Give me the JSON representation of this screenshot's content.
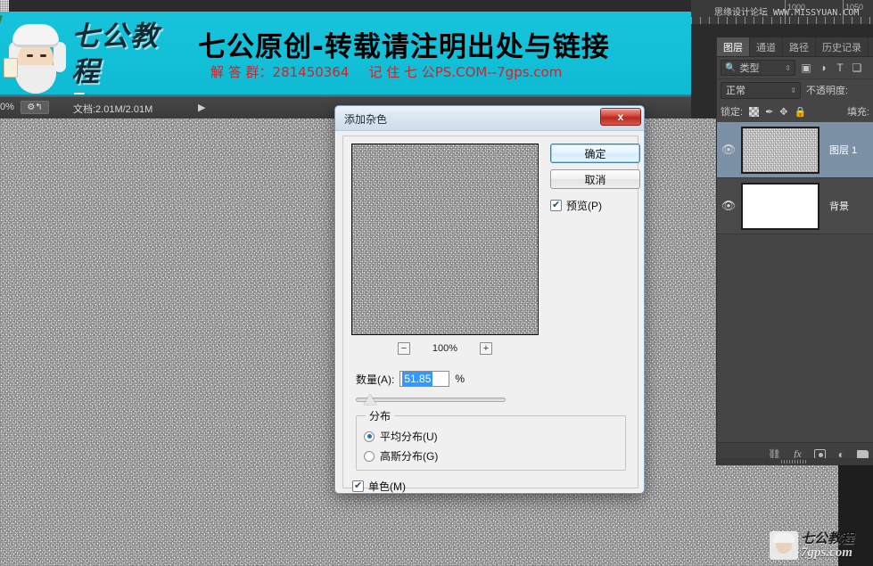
{
  "banner": {
    "logo_cn": "七公教程",
    "logo_en": "7gps.com",
    "headline": "七公原创-转载请注明出处与链接",
    "sub_qq_label": "解 答 群：",
    "sub_qq_number": "281450364",
    "sub_remember": "记 住 七 公PS.COM--7gps.com"
  },
  "statusbar": {
    "zoom": "0%",
    "doc_info": "文档:2.01M/2.01M",
    "arrow_icon": "▶",
    "proof_icon": "⚙↰"
  },
  "ruler": {
    "watermark": "思缘设计论坛 WWW.MISSYUAN.COM",
    "ticks": [
      "1000",
      "1050"
    ]
  },
  "panel": {
    "tabs": [
      {
        "label": "图层",
        "active": true
      },
      {
        "label": "通道",
        "active": false
      },
      {
        "label": "路径",
        "active": false
      },
      {
        "label": "历史记录",
        "active": false
      }
    ],
    "filter": {
      "magnifier_icon": "search-icon",
      "kind_label": "类型",
      "spinner": "⇳",
      "icons": [
        "image-filter-icon",
        "adjustment-filter-icon",
        "type-filter-icon",
        "shape-filter-icon"
      ],
      "type_icon_glyph": "T",
      "image_icon_glyph": "▣",
      "adjust_icon_glyph": "◑",
      "shape_icon_glyph": "❏"
    },
    "blend": {
      "mode": "正常",
      "opacity_label": "不透明度:",
      "spinner": "⇳"
    },
    "lock": {
      "label": "锁定:",
      "transparent_icon": "checker-lock-icon",
      "brush_icon": "✒",
      "move_icon": "✥",
      "all_icon": "🔒",
      "fill_label": "填充:"
    },
    "layers": [
      {
        "name": "图层 1",
        "visible": true,
        "selected": true,
        "thumb": "noise",
        "eye_icon": "👁"
      },
      {
        "name": "背景",
        "visible": true,
        "selected": false,
        "thumb": "white",
        "eye_icon": "👁"
      }
    ],
    "bottom_icons": [
      {
        "name": "link-layers-icon",
        "glyph": "⛓"
      },
      {
        "name": "layer-style-fx-icon",
        "glyph": "fx"
      },
      {
        "name": "layer-mask-icon",
        "glyph": ""
      },
      {
        "name": "adjustment-layer-icon",
        "glyph": "◐"
      },
      {
        "name": "new-group-icon",
        "glyph": ""
      }
    ]
  },
  "dialog": {
    "title": "添加杂色",
    "close_label": "x",
    "ok_label": "确定",
    "cancel_label": "取消",
    "preview_label": "预览(P)",
    "preview_checked": true,
    "zoom": {
      "minus": "−",
      "value": "100%",
      "plus": "+"
    },
    "amount": {
      "label": "数量(A):",
      "value": "51.85",
      "unit": "%"
    },
    "distribution": {
      "group_title": "分布",
      "options": [
        {
          "label": "平均分布(U)",
          "selected": true
        },
        {
          "label": "高斯分布(G)",
          "selected": false
        }
      ]
    },
    "monochrome": {
      "label": "单色(M)",
      "checked": true
    }
  },
  "watermark": {
    "cn": "七公教程",
    "en": "7gps.com"
  },
  "colors": {
    "banner_bg": "#12c0d8",
    "banner_sub": "#d2232a",
    "selection_blue": "#3399ff",
    "layer_selected": "#7c90a6",
    "panel_bg": "#454545",
    "dialog_bg": "#f0f0f0",
    "close_red": "#d94a3f"
  }
}
